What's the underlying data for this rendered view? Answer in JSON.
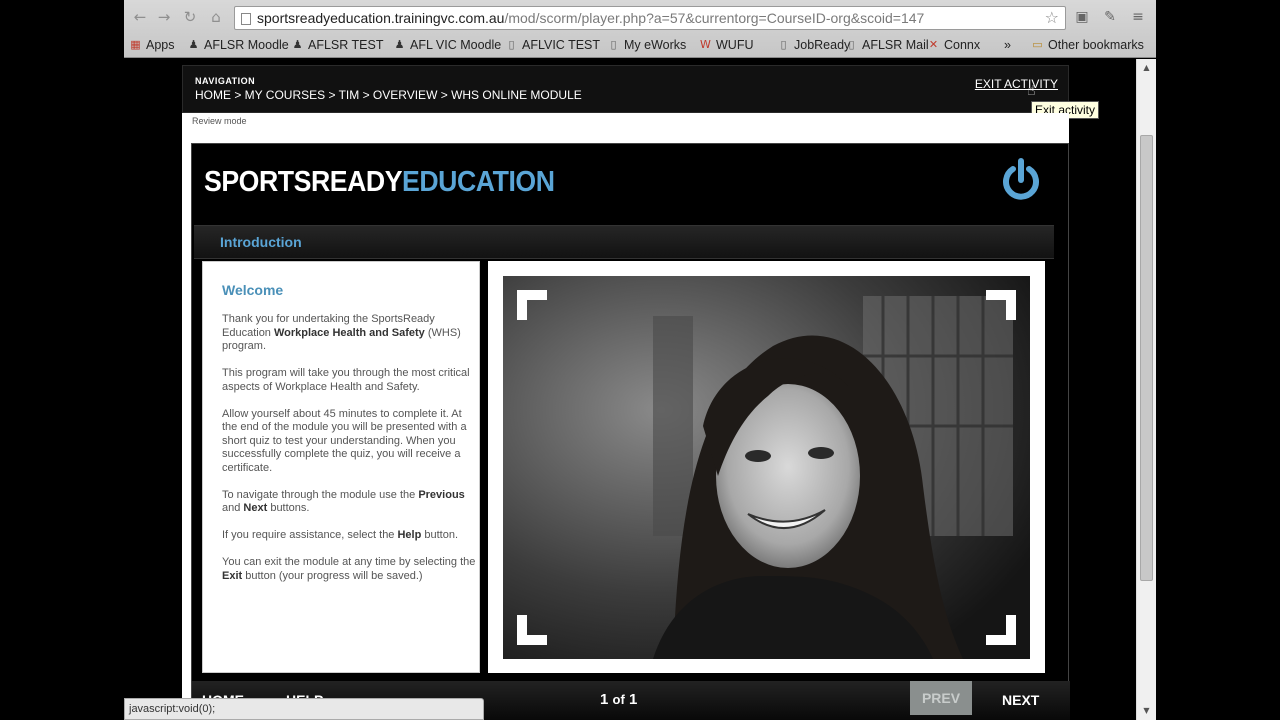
{
  "browser": {
    "url_host": "sportsreadyeducation.trainingvc.com.au",
    "url_path": "/mod/scorm/player.php?a=57&currentorg=CourseID-org&scoid=147",
    "bookmarks": [
      {
        "label": "Apps",
        "icon": "apps-grid-icon"
      },
      {
        "label": "AFLSR Moodle",
        "icon": "moodle-icon"
      },
      {
        "label": "AFLSR TEST",
        "icon": "moodle-icon"
      },
      {
        "label": "AFL VIC Moodle",
        "icon": "moodle-icon"
      },
      {
        "label": "AFLVIC TEST",
        "icon": "page-icon"
      },
      {
        "label": "My eWorks",
        "icon": "page-icon"
      },
      {
        "label": "WUFU",
        "icon": "wufu-icon"
      },
      {
        "label": "JobReady",
        "icon": "page-icon"
      },
      {
        "label": "AFLSR Mail",
        "icon": "page-icon"
      },
      {
        "label": "Connx",
        "icon": "connx-icon"
      }
    ],
    "overflow_label": "»",
    "other_bookmarks_label": "Other bookmarks",
    "status_text": "javascript:void(0);"
  },
  "moodle": {
    "nav_label": "NAVIGATION",
    "breadcrumb": "HOME > MY COURSES > TIM > OVERVIEW > WHS ONLINE MODULE",
    "exit_label": "EXIT ACTIVITY",
    "exit_tooltip": "Exit activity",
    "review_mode": "Review mode"
  },
  "module": {
    "brand_part1": "SPORTSREADY",
    "brand_part2": "EDUCATION",
    "section_title": "Introduction",
    "welcome_heading": "Welcome",
    "paragraphs": {
      "p1a": "Thank you for undertaking the SportsReady Education ",
      "p1b": "Workplace Health and Safety",
      "p1c": " (WHS) program.",
      "p2": "This program will take you through the most critical aspects of Workplace Health and Safety.",
      "p3": "Allow yourself about 45 minutes to complete it. At the end of the module you will be presented with a short quiz to test your understanding. When you successfully complete the quiz, you will receive a certificate.",
      "p4a": "To navigate through the module use the ",
      "p4b": "Previous",
      "p4c": " and ",
      "p4d": "Next",
      "p4e": " buttons.",
      "p5a": "If you require assistance, select the ",
      "p5b": "Help",
      "p5c": " button.",
      "p6a": "You can exit the module at any time by selecting the ",
      "p6b": "Exit",
      "p6c": " button (your progress will be saved.)"
    },
    "bottom": {
      "home_label": "HOME",
      "help_label": "HELP",
      "page_current": "1",
      "page_of": "of",
      "page_total": "1",
      "prev_label": "PREV",
      "next_label": "NEXT"
    },
    "colors": {
      "accent_blue": "#5aa5d6",
      "prev_disabled": "#8a8f8e"
    }
  }
}
